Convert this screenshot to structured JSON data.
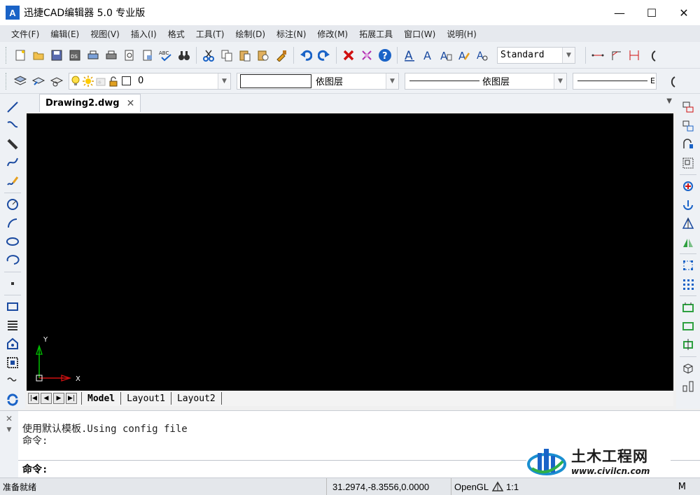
{
  "window": {
    "app_icon_letter": "A",
    "title": "迅捷CAD编辑器 5.0 专业版",
    "minimize": "—",
    "maximize": "☐",
    "close": "✕"
  },
  "menu": [
    {
      "label": "文件(F)"
    },
    {
      "label": "编辑(E)"
    },
    {
      "label": "视图(V)"
    },
    {
      "label": "插入(I)"
    },
    {
      "label": "格式"
    },
    {
      "label": "工具(T)"
    },
    {
      "label": "绘制(D)"
    },
    {
      "label": "标注(N)"
    },
    {
      "label": "修改(M)"
    },
    {
      "label": "拓展工具"
    },
    {
      "label": "窗口(W)"
    },
    {
      "label": "说明(H)"
    }
  ],
  "toolbar": {
    "text_style": "Standard",
    "layer_value": "0",
    "color_value": "依图层",
    "linetype_value": "依图层",
    "lineweight_value": "",
    "trailing_letter": "E"
  },
  "document": {
    "tab_label": "Drawing2.dwg",
    "tab_close": "✕"
  },
  "ucs": {
    "y_label": "Y",
    "x_label": "X"
  },
  "layout_tabs": [
    {
      "label": "Model",
      "active": true
    },
    {
      "label": "Layout1",
      "active": false
    },
    {
      "label": "Layout2",
      "active": false
    }
  ],
  "command": {
    "history_line1": "使用默认模板.Using config file",
    "history_line2": "命令:",
    "prompt": "命令:",
    "input_value": ""
  },
  "watermark": {
    "title": "土木工程网",
    "url": "www.civilcn.com"
  },
  "status": {
    "ready": "准备就绪",
    "coords": "31.2974,-8.3556,0.0000",
    "renderer": "OpenGL",
    "scale": "1:1",
    "trailing": "M"
  },
  "colors": {
    "canvas": "#000000",
    "accent_blue": "#1a63c7",
    "ucs_y": "#00c000",
    "ucs_x": "#d01010"
  }
}
